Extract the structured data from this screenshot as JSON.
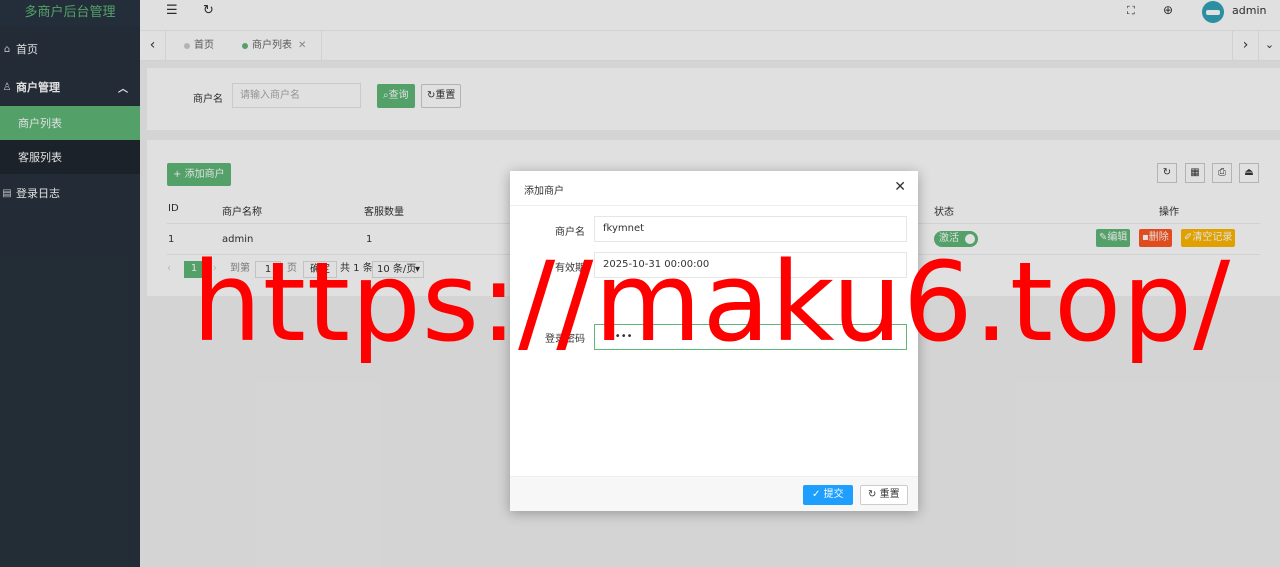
{
  "sidebar": {
    "logo": "多商户后台管理",
    "items": [
      {
        "label": "首页",
        "icon": "home-icon"
      },
      {
        "label": "商户管理",
        "icon": "user-icon",
        "expanded": true,
        "children": [
          {
            "label": "商户列表",
            "active": true
          },
          {
            "label": "客服列表",
            "active": false
          }
        ]
      },
      {
        "label": "登录日志",
        "icon": "log-icon"
      }
    ]
  },
  "header": {
    "menu_icon": "menu-fold-icon",
    "refresh_icon": "refresh-icon",
    "fullscreen_icon": "fullscreen-icon",
    "language_icon": "globe-icon",
    "username": "admin"
  },
  "tabs": [
    {
      "label": "首页",
      "active": false
    },
    {
      "label": "商户列表",
      "active": true,
      "closable": true
    }
  ],
  "search": {
    "label": "商户名",
    "placeholder": "请输入商户名",
    "query_label": "查询",
    "reset_label": "重置"
  },
  "table": {
    "add_label": "添加商户",
    "columns": [
      "ID",
      "商户名称",
      "客服数量",
      "状态",
      "操作"
    ],
    "rows": [
      {
        "id": "1",
        "name": "admin",
        "cs_count": "1",
        "status": "激活",
        "actions": [
          "编辑",
          "删除",
          "清空记录"
        ]
      }
    ],
    "pagination": {
      "current": "1",
      "goto_label": "到第",
      "goto_value": "1",
      "page_unit": "页",
      "confirm_label": "确定",
      "total_text": "共 1 条",
      "page_size": "10 条/页"
    }
  },
  "modal": {
    "title": "添加商户",
    "fields": [
      {
        "label": "商户名",
        "value": "fkymnet"
      },
      {
        "label": "有效期",
        "value": "2025-10-31 00:00:00"
      },
      {
        "label": "登录密码",
        "value": "•••••"
      }
    ],
    "submit_label": "提交",
    "reset_label": "重置"
  },
  "watermark": "https://maku6.top/",
  "colors": {
    "sidebar_bg": "#28333e",
    "accent_green": "#5fb878",
    "danger_red": "#ff5722",
    "warn_orange": "#ffb800",
    "modal_submit_blue": "#1e9fff",
    "watermark_red": "#ff0000"
  }
}
